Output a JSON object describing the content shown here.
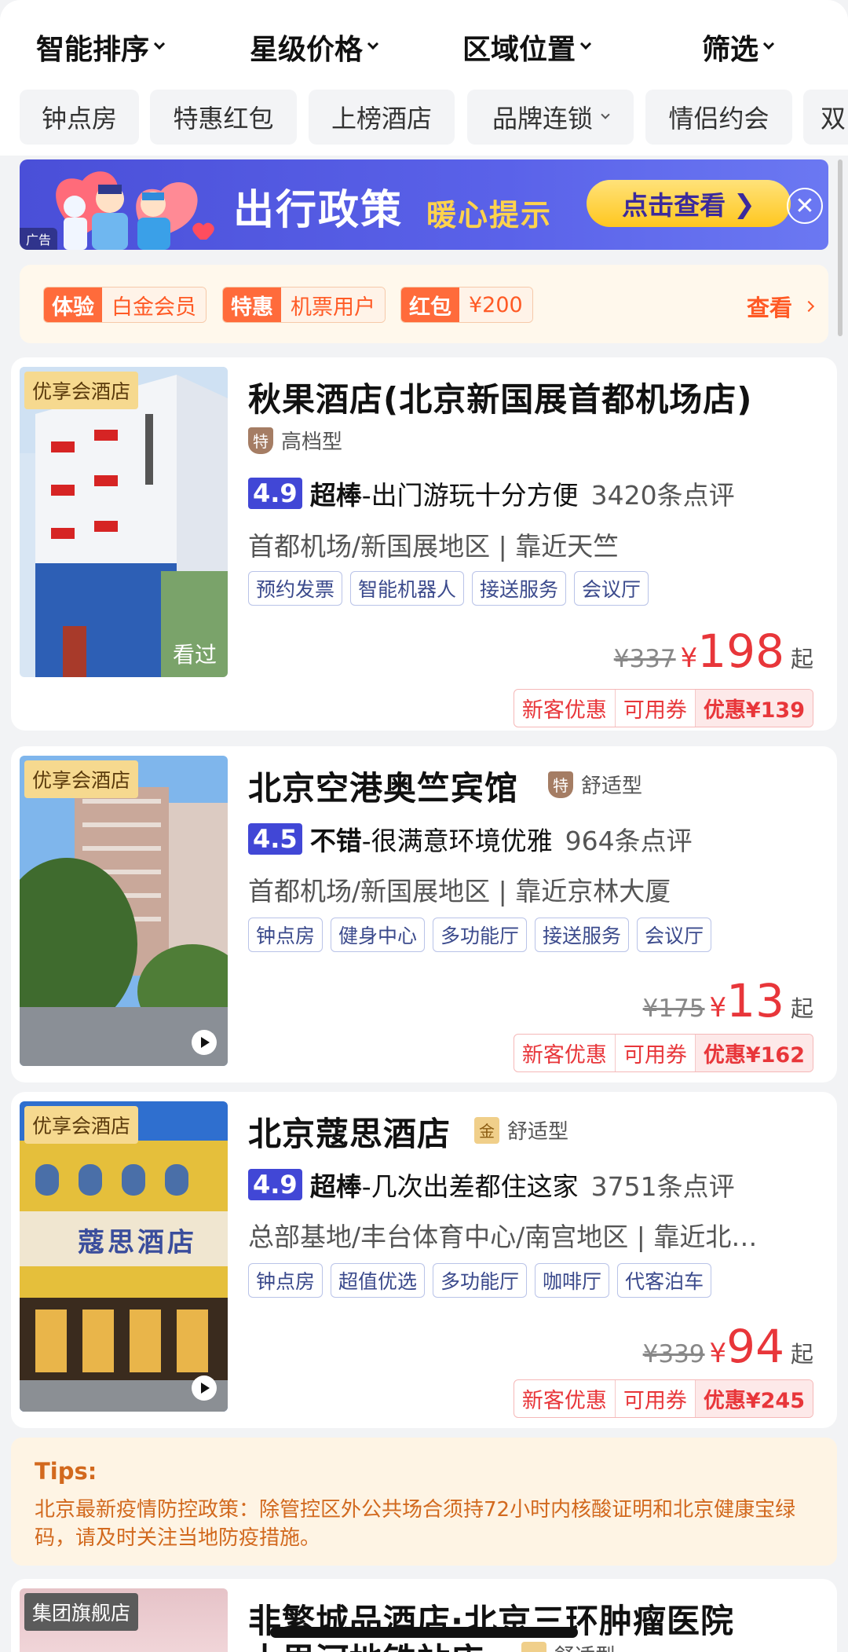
{
  "sort_bar": {
    "items": [
      "智能排序",
      "星级价格",
      "区域位置",
      "筛选"
    ]
  },
  "quick_tags": [
    {
      "label": "钟点房",
      "dropdown": false
    },
    {
      "label": "特惠红包",
      "dropdown": false
    },
    {
      "label": "上榜酒店",
      "dropdown": false
    },
    {
      "label": "品牌连锁",
      "dropdown": true
    },
    {
      "label": "情侣约会",
      "dropdown": false
    },
    {
      "label": "双",
      "dropdown": false
    }
  ],
  "banner": {
    "title": "出行政策",
    "subtitle": "暖心提示",
    "cta": "点击查看",
    "ad_label": "广告",
    "close_icon": "close-icon"
  },
  "member_strip": {
    "chips": [
      {
        "key": "体验",
        "value": "白金会员"
      },
      {
        "key": "特惠",
        "value": "机票用户"
      },
      {
        "key": "红包",
        "value": "¥200"
      }
    ],
    "view_label": "查看"
  },
  "hotels": [
    {
      "badge": "优享会酒店",
      "name": "秋果酒店(北京新国展首都机场店)",
      "level_icon": "特",
      "level": "高档型",
      "score": "4.9",
      "rating_word": "超棒",
      "rating_desc": "-出门游玩十分方便",
      "reviews": "3420条点评",
      "location": "首都机场/新国展地区 | 靠近天竺",
      "amenities": [
        "预约发票",
        "智能机器人",
        "接送服务",
        "会议厅"
      ],
      "orig_price": "¥337",
      "currency": "¥",
      "price": "198",
      "price_suffix": "起",
      "deals": [
        "新客优惠",
        "可用券",
        "优惠¥139"
      ],
      "photo_note": "看过"
    },
    {
      "badge": "优享会酒店",
      "name": "北京空港奥竺宾馆",
      "level_icon": "特",
      "level": "舒适型",
      "score": "4.5",
      "rating_word": "不错",
      "rating_desc": "-很满意环境优雅",
      "reviews": "964条点评",
      "location": "首都机场/新国展地区 | 靠近京林大厦",
      "amenities": [
        "钟点房",
        "健身中心",
        "多功能厅",
        "接送服务",
        "会议厅"
      ],
      "orig_price": "¥175",
      "currency": "¥",
      "price": "13",
      "price_suffix": "起",
      "deals": [
        "新客优惠",
        "可用券",
        "优惠¥162"
      ]
    },
    {
      "badge": "优享会酒店",
      "name": "北京蔻思酒店",
      "level_icon": "金",
      "level": "舒适型",
      "score": "4.9",
      "rating_word": "超棒",
      "rating_desc": "-几次出差都住这家",
      "reviews": "3751条点评",
      "location": "总部基地/丰台体育中心/南宫地区 | 靠近北…",
      "amenities": [
        "钟点房",
        "超值优选",
        "多功能厅",
        "咖啡厅",
        "代客泊车"
      ],
      "orig_price": "¥339",
      "currency": "¥",
      "price": "94",
      "price_suffix": "起",
      "deals": [
        "新客优惠",
        "可用券",
        "优惠¥245"
      ],
      "photo_sign": "蔻思酒店"
    },
    {
      "badge": "集团旗舰店",
      "name": "非繁城品酒店·北京三环肿瘤医院",
      "name_line2": "十里河地铁站店",
      "level": "舒适型"
    }
  ],
  "tips": {
    "title": "Tips:",
    "text": "北京最新疫情防控政策：除管控区外公共场合须持72小时内核酸证明和北京健康宝绿码，请及时关注当地防疫措施。"
  }
}
